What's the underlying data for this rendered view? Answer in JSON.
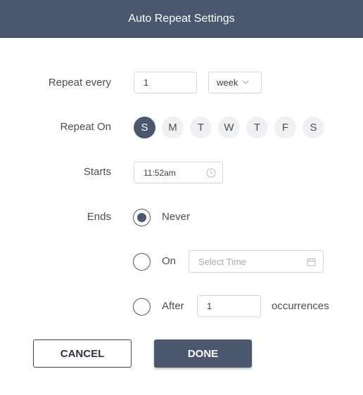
{
  "header": {
    "title": "Auto Repeat Settings"
  },
  "repeat_every": {
    "label": "Repeat every",
    "value": "1",
    "unit": "week"
  },
  "repeat_on": {
    "label": "Repeat On",
    "days": [
      "S",
      "M",
      "T",
      "W",
      "T",
      "F",
      "S"
    ],
    "selected_index": 0
  },
  "starts": {
    "label": "Starts",
    "value": "11:52am"
  },
  "ends": {
    "label": "Ends",
    "selected": "never",
    "options": {
      "never": {
        "label": "Never"
      },
      "on": {
        "label": "On",
        "placeholder": "Select Time"
      },
      "after": {
        "label": "After",
        "value": "1",
        "suffix": "occurrences"
      }
    }
  },
  "buttons": {
    "cancel": "CANCEL",
    "done": "DONE"
  },
  "colors": {
    "header_bg": "#4a576d",
    "accent": "#4a576d",
    "day_bg": "#eef0f3"
  },
  "icons": {
    "starts_field": "clock-icon",
    "on_field": "calendar-icon",
    "dropdown": "chevron-down-icon"
  }
}
